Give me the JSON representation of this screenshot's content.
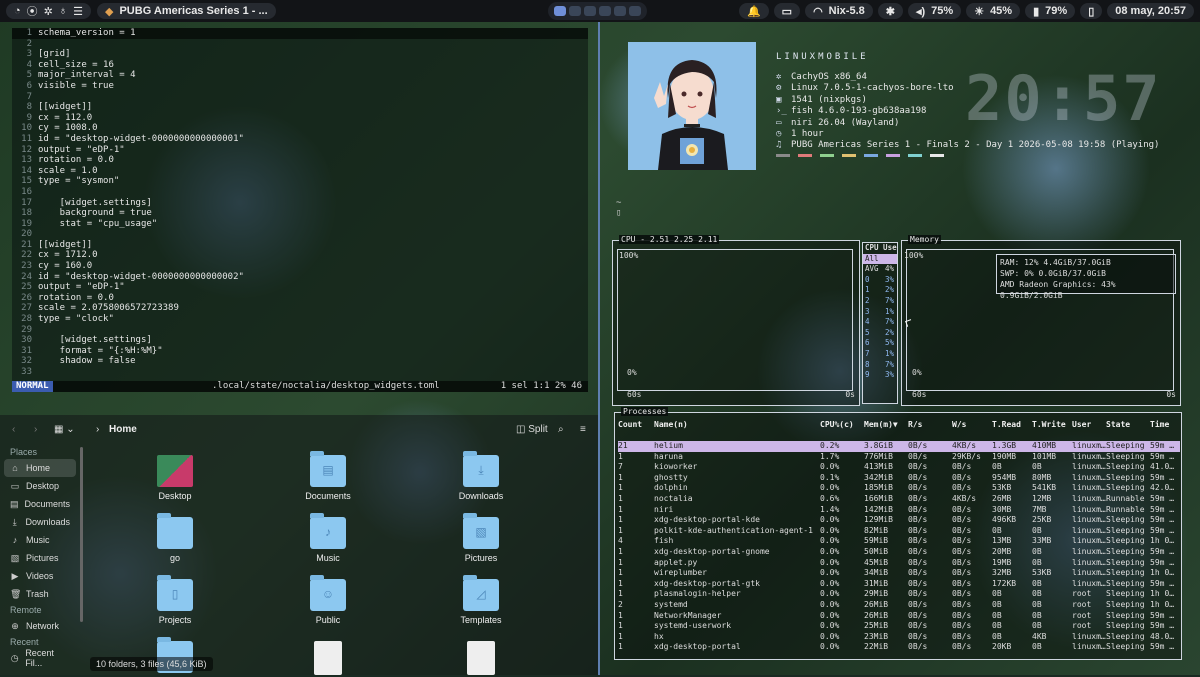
{
  "topbar": {
    "left_icons": [
      "◔",
      "⦿",
      "✲",
      "♁",
      "☰"
    ],
    "window_title": "PUBG Americas Series 1 - ...",
    "workspaces": [
      "1",
      "2",
      "3",
      "4",
      "5",
      "6"
    ],
    "workspace_active": "1",
    "status": {
      "bell": "🔔",
      "clipboard": "▭",
      "network": "Nix-5.8",
      "bluetooth": "✱",
      "volume": "75%",
      "brightness": "45%",
      "battery": "79%",
      "lock": "▯",
      "date_time": "08 may, 20:57"
    }
  },
  "editor": {
    "lines": [
      {
        "n": "",
        "t": "schema_version = 1"
      },
      {
        "n": "2",
        "t": ""
      },
      {
        "n": "3",
        "t": "[grid]"
      },
      {
        "n": "4",
        "t": "cell_size = 16"
      },
      {
        "n": "5",
        "t": "major_interval = 4"
      },
      {
        "n": "6",
        "t": "visible = true"
      },
      {
        "n": "7",
        "t": ""
      },
      {
        "n": "8",
        "t": "[[widget]]"
      },
      {
        "n": "9",
        "t": "cx = 112.0"
      },
      {
        "n": "10",
        "t": "cy = 1008.0"
      },
      {
        "n": "11",
        "t": "id = \"desktop-widget-0000000000000001\""
      },
      {
        "n": "12",
        "t": "output = \"eDP-1\""
      },
      {
        "n": "13",
        "t": "rotation = 0.0"
      },
      {
        "n": "14",
        "t": "scale = 1.0"
      },
      {
        "n": "15",
        "t": "type = \"sysmon\""
      },
      {
        "n": "16",
        "t": ""
      },
      {
        "n": "17",
        "t": "    [widget.settings]"
      },
      {
        "n": "18",
        "t": "    background = true"
      },
      {
        "n": "19",
        "t": "    stat = \"cpu_usage\""
      },
      {
        "n": "20",
        "t": ""
      },
      {
        "n": "21",
        "t": "[[widget]]"
      },
      {
        "n": "22",
        "t": "cx = 1712.0"
      },
      {
        "n": "23",
        "t": "cy = 160.0"
      },
      {
        "n": "24",
        "t": "id = \"desktop-widget-0000000000000002\""
      },
      {
        "n": "25",
        "t": "output = \"eDP-1\""
      },
      {
        "n": "26",
        "t": "rotation = 0.0"
      },
      {
        "n": "27",
        "t": "scale = 2.0758006572723389"
      },
      {
        "n": "28",
        "t": "type = \"clock\""
      },
      {
        "n": "29",
        "t": ""
      },
      {
        "n": "30",
        "t": "    [widget.settings]"
      },
      {
        "n": "31",
        "t": "    format = \"{:%H:%M}\""
      },
      {
        "n": "32",
        "t": "    shadow = false"
      },
      {
        "n": "33",
        "t": ""
      }
    ],
    "first_line_num": "1",
    "mode": "NORMAL",
    "path": ".local/state/noctalia/desktop_widgets.toml",
    "position": "1 sel   1:1  2%  46"
  },
  "file_manager": {
    "location": "Home",
    "split_label": "Split",
    "places_header": "Places",
    "places": [
      {
        "label": "Home",
        "icon": "⌂"
      },
      {
        "label": "Desktop",
        "icon": "▭"
      },
      {
        "label": "Documents",
        "icon": "▤"
      },
      {
        "label": "Downloads",
        "icon": "⤓"
      },
      {
        "label": "Music",
        "icon": "♪"
      },
      {
        "label": "Pictures",
        "icon": "▧"
      },
      {
        "label": "Videos",
        "icon": "▶"
      },
      {
        "label": "Trash",
        "icon": "🗑"
      }
    ],
    "remote_header": "Remote",
    "remote": [
      {
        "label": "Network",
        "icon": "⊕"
      }
    ],
    "recent_header": "Recent",
    "recent": [
      {
        "label": "Recent Fil...",
        "icon": "◷"
      }
    ],
    "tiles": [
      {
        "label": "Desktop",
        "glyph": "",
        "kind": "desktop"
      },
      {
        "label": "Documents",
        "glyph": "▤",
        "kind": "folder"
      },
      {
        "label": "Downloads",
        "glyph": "⤓",
        "kind": "folder"
      },
      {
        "label": "go",
        "glyph": "",
        "kind": "folder"
      },
      {
        "label": "Music",
        "glyph": "♪",
        "kind": "folder"
      },
      {
        "label": "Pictures",
        "glyph": "▧",
        "kind": "folder"
      },
      {
        "label": "Projects",
        "glyph": "▯",
        "kind": "folder"
      },
      {
        "label": "Public",
        "glyph": "☺",
        "kind": "folder"
      },
      {
        "label": "Templates",
        "glyph": "◿",
        "kind": "folder"
      },
      {
        "label": "",
        "glyph": "",
        "kind": "folder"
      },
      {
        "label": "",
        "glyph": "",
        "kind": "doc"
      },
      {
        "label": "",
        "glyph": "",
        "kind": "doc"
      }
    ],
    "status": "10 folders, 3 files (45,6 KiB)"
  },
  "fastfetch": {
    "title": "LINUXMOBILE",
    "lines": [
      {
        "icon": "✲",
        "text": "CachyOS x86_64"
      },
      {
        "icon": "⚙",
        "text": "Linux 7.0.5-1-cachyos-bore-lto"
      },
      {
        "icon": "▣",
        "text": "1541 (nixpkgs)"
      },
      {
        "icon": "›_",
        "text": "fish 4.6.0-193-gb638aa198"
      },
      {
        "icon": "▭",
        "text": "niri 26.04 (Wayland)"
      },
      {
        "icon": "◷",
        "text": "1 hour"
      },
      {
        "icon": "♫",
        "text": "PUBG Americas Series 1 - Finals 2 - Day 1 2026-05-08 19:58 (Playing)"
      }
    ],
    "palette": [
      "#8a8a8a",
      "#e07a7a",
      "#8fd08f",
      "#e0c070",
      "#7aa8e0",
      "#c8a0e0",
      "#80d0d0",
      "#e8e8e8"
    ],
    "clock": "20:57",
    "prompt_line1": "~",
    "prompt_line2": "▯"
  },
  "btop": {
    "cpu_title": "CPU - 2.51 2.25 2.11",
    "cpu_top": "100%",
    "cpu_bottom": "0%",
    "cpu_time_left": "60s",
    "cpu_time_right": "0s",
    "cpu_use_title": "CPU Use",
    "cpu_rows": [
      {
        "k": "All",
        "v": ""
      },
      {
        "k": "AVG",
        "v": "4%"
      },
      {
        "k": "0",
        "v": "3%"
      },
      {
        "k": "1",
        "v": "2%"
      },
      {
        "k": "2",
        "v": "7%"
      },
      {
        "k": "3",
        "v": "1%"
      },
      {
        "k": "4",
        "v": "7%"
      },
      {
        "k": "5",
        "v": "2%"
      },
      {
        "k": "6",
        "v": "5%"
      },
      {
        "k": "7",
        "v": "1%"
      },
      {
        "k": "8",
        "v": "7%"
      },
      {
        "k": "9",
        "v": "3%"
      }
    ],
    "mem_title": "Memory",
    "mem_top": "100%",
    "mem_bottom": "0%",
    "mem_time_left": "60s",
    "mem_time_right": "0s",
    "mem_lines": [
      "RAM: 12%   4.4GiB/37.0GiB",
      "SWP:  0%   0.0GiB/37.0GiB",
      "AMD Radeon Graphics: 43%   0.9GiB/2.0GiB"
    ],
    "proc_title": "Processes",
    "columns": [
      "Count",
      "Name(n)",
      "CPU%(c)",
      "Mem(m)▼",
      "R/s",
      "W/s",
      "T.Read",
      "T.Write",
      "User",
      "State",
      "Time"
    ],
    "rows": [
      [
        "21",
        "helium",
        "0.2%",
        "3.8GiB",
        "0B/s",
        "4KB/s",
        "1.3GB",
        "410MB",
        "linuxm…",
        "Sleeping",
        "59m …"
      ],
      [
        "1",
        "haruna",
        "1.7%",
        "776MiB",
        "0B/s",
        "29KB/s",
        "190MB",
        "101MB",
        "linuxm…",
        "Sleeping",
        "59m …"
      ],
      [
        "7",
        "kioworker",
        "0.0%",
        "413MiB",
        "0B/s",
        "0B/s",
        "0B",
        "0B",
        "linuxm…",
        "Sleeping",
        "41.0…"
      ],
      [
        "1",
        "ghostty",
        "0.1%",
        "342MiB",
        "0B/s",
        "0B/s",
        "954MB",
        "80MB",
        "linuxm…",
        "Sleeping",
        "59m …"
      ],
      [
        "1",
        "dolphin",
        "0.0%",
        "185MiB",
        "0B/s",
        "0B/s",
        "53KB",
        "541KB",
        "linuxm…",
        "Sleeping",
        "42.0…"
      ],
      [
        "1",
        "noctalia",
        "0.6%",
        "166MiB",
        "0B/s",
        "4KB/s",
        "26MB",
        "12MB",
        "linuxm…",
        "Runnable",
        "59m …"
      ],
      [
        "1",
        "niri",
        "1.4%",
        "142MiB",
        "0B/s",
        "0B/s",
        "30MB",
        "7MB",
        "linuxm…",
        "Runnable",
        "59m …"
      ],
      [
        "1",
        "xdg-desktop-portal-kde",
        "0.0%",
        "129MiB",
        "0B/s",
        "0B/s",
        "496KB",
        "25KB",
        "linuxm…",
        "Sleeping",
        "59m …"
      ],
      [
        "1",
        "polkit-kde-authentication-agent-1",
        "0.0%",
        "82MiB",
        "0B/s",
        "0B/s",
        "0B",
        "0B",
        "linuxm…",
        "Sleeping",
        "59m …"
      ],
      [
        "4",
        "fish",
        "0.0%",
        "59MiB",
        "0B/s",
        "0B/s",
        "13MB",
        "33MB",
        "linuxm…",
        "Sleeping",
        "1h 0…"
      ],
      [
        "1",
        "xdg-desktop-portal-gnome",
        "0.0%",
        "50MiB",
        "0B/s",
        "0B/s",
        "20MB",
        "0B",
        "linuxm…",
        "Sleeping",
        "59m …"
      ],
      [
        "1",
        "applet.py",
        "0.0%",
        "45MiB",
        "0B/s",
        "0B/s",
        "19MB",
        "0B",
        "linuxm…",
        "Sleeping",
        "59m …"
      ],
      [
        "1",
        "wireplumber",
        "0.0%",
        "34MiB",
        "0B/s",
        "0B/s",
        "32MB",
        "53KB",
        "linuxm…",
        "Sleeping",
        "1h 0…"
      ],
      [
        "1",
        "xdg-desktop-portal-gtk",
        "0.0%",
        "31MiB",
        "0B/s",
        "0B/s",
        "172KB",
        "0B",
        "linuxm…",
        "Sleeping",
        "59m …"
      ],
      [
        "1",
        "plasmalogin-helper",
        "0.0%",
        "29MiB",
        "0B/s",
        "0B/s",
        "0B",
        "0B",
        "root",
        "Sleeping",
        "1h 0…"
      ],
      [
        "2",
        "systemd",
        "0.0%",
        "26MiB",
        "0B/s",
        "0B/s",
        "0B",
        "0B",
        "root",
        "Sleeping",
        "1h 0…"
      ],
      [
        "1",
        "NetworkManager",
        "0.0%",
        "26MiB",
        "0B/s",
        "0B/s",
        "0B",
        "0B",
        "root",
        "Sleeping",
        "59m …"
      ],
      [
        "1",
        "systemd-userwork",
        "0.0%",
        "25MiB",
        "0B/s",
        "0B/s",
        "0B",
        "0B",
        "root",
        "Sleeping",
        "59m …"
      ],
      [
        "1",
        "hx",
        "0.0%",
        "23MiB",
        "0B/s",
        "0B/s",
        "0B",
        "4KB",
        "linuxm…",
        "Sleeping",
        "48.0…"
      ],
      [
        "1",
        "xdg-desktop-portal",
        "0.0%",
        "22MiB",
        "0B/s",
        "0B/s",
        "20KB",
        "0B",
        "linuxm…",
        "Sleeping",
        "59m …"
      ]
    ]
  }
}
